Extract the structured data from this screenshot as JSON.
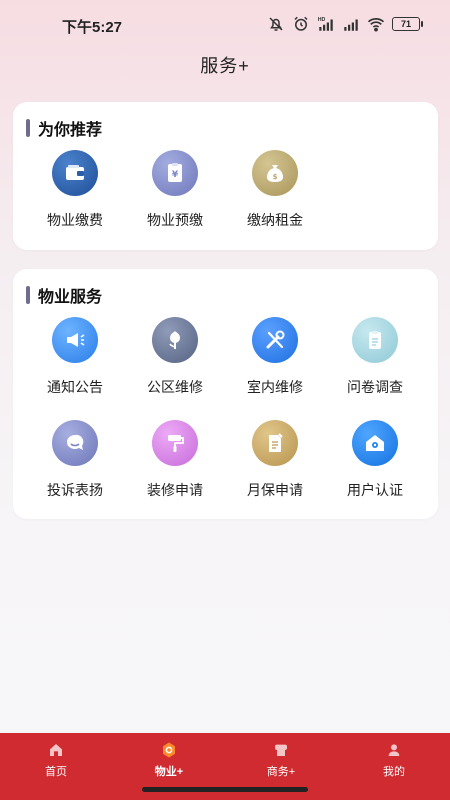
{
  "status_bar": {
    "time": "下午5:27",
    "network_label": "HD",
    "battery": "71"
  },
  "header": {
    "title": "服务+"
  },
  "recommend": {
    "title": "为你推荐",
    "items": [
      {
        "label": "物业缴费",
        "icon": "wallet-icon",
        "color": "#2b5ea8"
      },
      {
        "label": "物业预缴",
        "icon": "receipt-yen-icon",
        "color": "#7b86c8"
      },
      {
        "label": "缴纳租金",
        "icon": "money-bag-icon",
        "color": "#b9a66c"
      }
    ]
  },
  "services": {
    "title": "物业服务",
    "items": [
      {
        "label": "通知公告",
        "icon": "megaphone-icon",
        "color": "#3a8ff0"
      },
      {
        "label": "公区维修",
        "icon": "tulip-icon",
        "color": "#667494"
      },
      {
        "label": "室内维修",
        "icon": "tools-icon",
        "color": "#2f7ff0"
      },
      {
        "label": "问卷调查",
        "icon": "clipboard-icon",
        "color": "#a9d8e2"
      },
      {
        "label": "投诉表扬",
        "icon": "chat-bubble-icon",
        "color": "#7d86c4"
      },
      {
        "label": "装修申请",
        "icon": "paint-roller-icon",
        "color": "#d783e6"
      },
      {
        "label": "月保申请",
        "icon": "document-edit-icon",
        "color": "#c9a968"
      },
      {
        "label": "用户认证",
        "icon": "house-camera-icon",
        "color": "#1f86f0"
      }
    ]
  },
  "bottom_nav": {
    "items": [
      {
        "label": "首页",
        "icon": "home-icon"
      },
      {
        "label": "物业+",
        "icon": "property-icon",
        "active": true
      },
      {
        "label": "商务+",
        "icon": "business-icon"
      },
      {
        "label": "我的",
        "icon": "profile-icon"
      }
    ],
    "background": "#cf2b30"
  }
}
